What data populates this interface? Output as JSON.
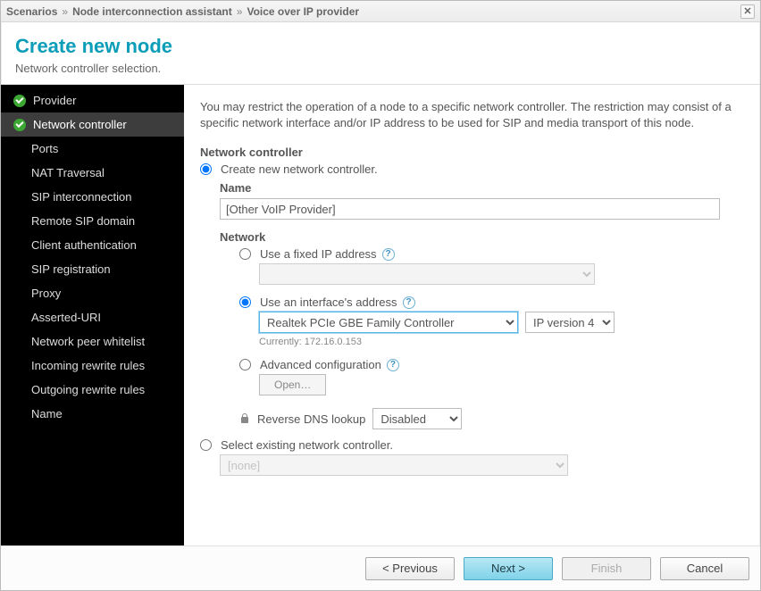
{
  "titlebar": {
    "crumbs": [
      "Scenarios",
      "Node interconnection assistant",
      "Voice over IP provider"
    ],
    "sep": "»"
  },
  "header": {
    "title": "Create new node",
    "subtitle": "Network controller selection."
  },
  "sidebar": [
    {
      "label": "Provider",
      "done": true,
      "active": false,
      "indent": false
    },
    {
      "label": "Network controller",
      "done": true,
      "active": true,
      "indent": false
    },
    {
      "label": "Ports",
      "done": false,
      "active": false,
      "indent": true
    },
    {
      "label": "NAT Traversal",
      "done": false,
      "active": false,
      "indent": true
    },
    {
      "label": "SIP interconnection",
      "done": false,
      "active": false,
      "indent": true
    },
    {
      "label": "Remote SIP domain",
      "done": false,
      "active": false,
      "indent": true
    },
    {
      "label": "Client authentication",
      "done": false,
      "active": false,
      "indent": true
    },
    {
      "label": "SIP registration",
      "done": false,
      "active": false,
      "indent": true
    },
    {
      "label": "Proxy",
      "done": false,
      "active": false,
      "indent": true
    },
    {
      "label": "Asserted-URI",
      "done": false,
      "active": false,
      "indent": true
    },
    {
      "label": "Network peer whitelist",
      "done": false,
      "active": false,
      "indent": true
    },
    {
      "label": "Incoming rewrite rules",
      "done": false,
      "active": false,
      "indent": true
    },
    {
      "label": "Outgoing rewrite rules",
      "done": false,
      "active": false,
      "indent": true
    },
    {
      "label": "Name",
      "done": false,
      "active": false,
      "indent": true
    }
  ],
  "main": {
    "description": "You may restrict the operation of a node to a specific network controller. The restriction may consist of a specific network interface and/or IP address to be used for SIP and media transport of this node.",
    "section_label": "Network controller",
    "create_radio": "Create new network controller.",
    "name_label": "Name",
    "name_value": "[Other VoIP Provider]",
    "network_label": "Network",
    "fixed_ip_radio": "Use a fixed IP address",
    "fixed_ip_value": "",
    "interface_radio": "Use an interface's address",
    "interface_value": "Realtek PCIe GBE Family Controller",
    "ipver_value": "IP version 4",
    "currently": "Currently: 172.16.0.153",
    "advanced_radio": "Advanced configuration",
    "open_btn": "Open…",
    "revdns_label": "Reverse DNS lookup",
    "revdns_value": "Disabled",
    "select_existing_radio": "Select existing network controller.",
    "existing_value": "[none]"
  },
  "footer": {
    "previous": "< Previous",
    "next": "Next >",
    "finish": "Finish",
    "cancel": "Cancel"
  }
}
